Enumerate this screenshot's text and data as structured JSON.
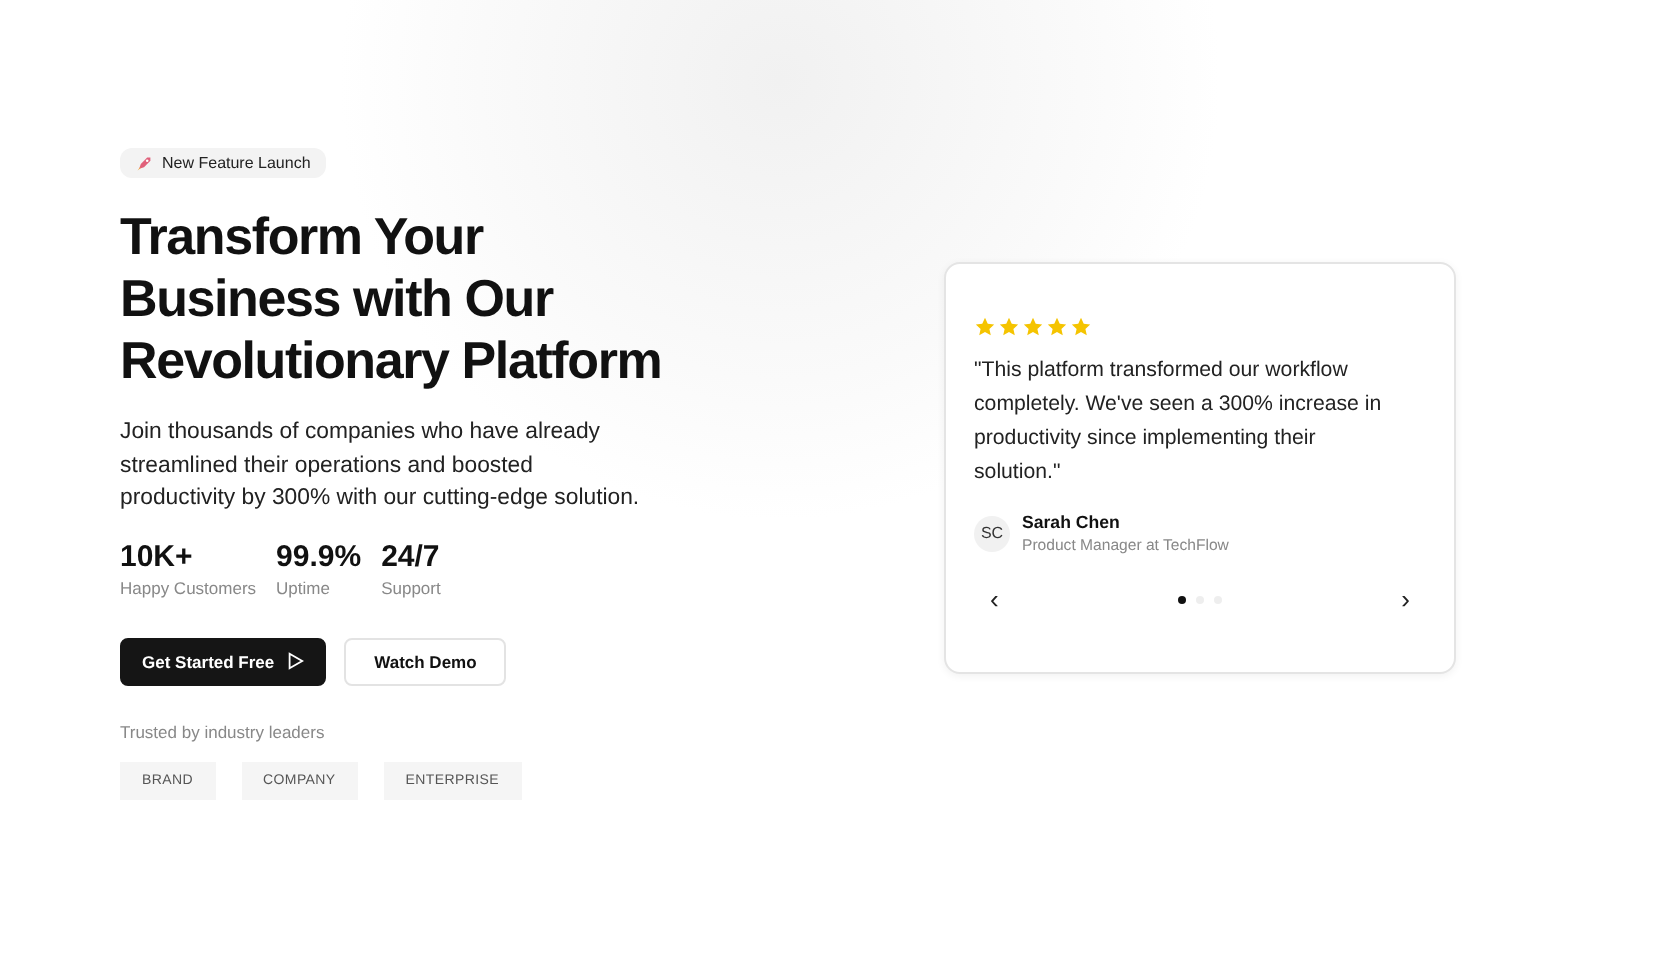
{
  "badge": {
    "label": "New Feature Launch"
  },
  "headline": "Transform Your Business with Our Revolutionary Platform",
  "description": "Join thousands of companies who have already streamlined their operations and boosted productivity by 300% with our cutting-edge solution.",
  "stats": [
    {
      "value": "10K+",
      "label": "Happy Customers"
    },
    {
      "value": "99.9%",
      "label": "Uptime"
    },
    {
      "value": "24/7",
      "label": "Support"
    }
  ],
  "buttons": [
    {
      "label": "Get Started Free",
      "kind": "primary"
    },
    {
      "label": "Watch Demo",
      "kind": "secondary"
    }
  ],
  "trusted": {
    "label": "Trusted by industry leaders",
    "logos": [
      "BRAND",
      "COMPANY",
      "ENTERPRISE"
    ]
  },
  "testimonial": {
    "stars": 5,
    "quote": "\"This platform transformed our workflow completely. We've seen a 300% increase in productivity since implementing their solution.\"",
    "initials": "SC",
    "name": "Sarah Chen",
    "role": "Product Manager at TechFlow",
    "prev": "‹",
    "next": "›",
    "dots": [
      {
        "selected": true
      },
      {
        "selected": false
      },
      {
        "selected": false
      }
    ]
  }
}
